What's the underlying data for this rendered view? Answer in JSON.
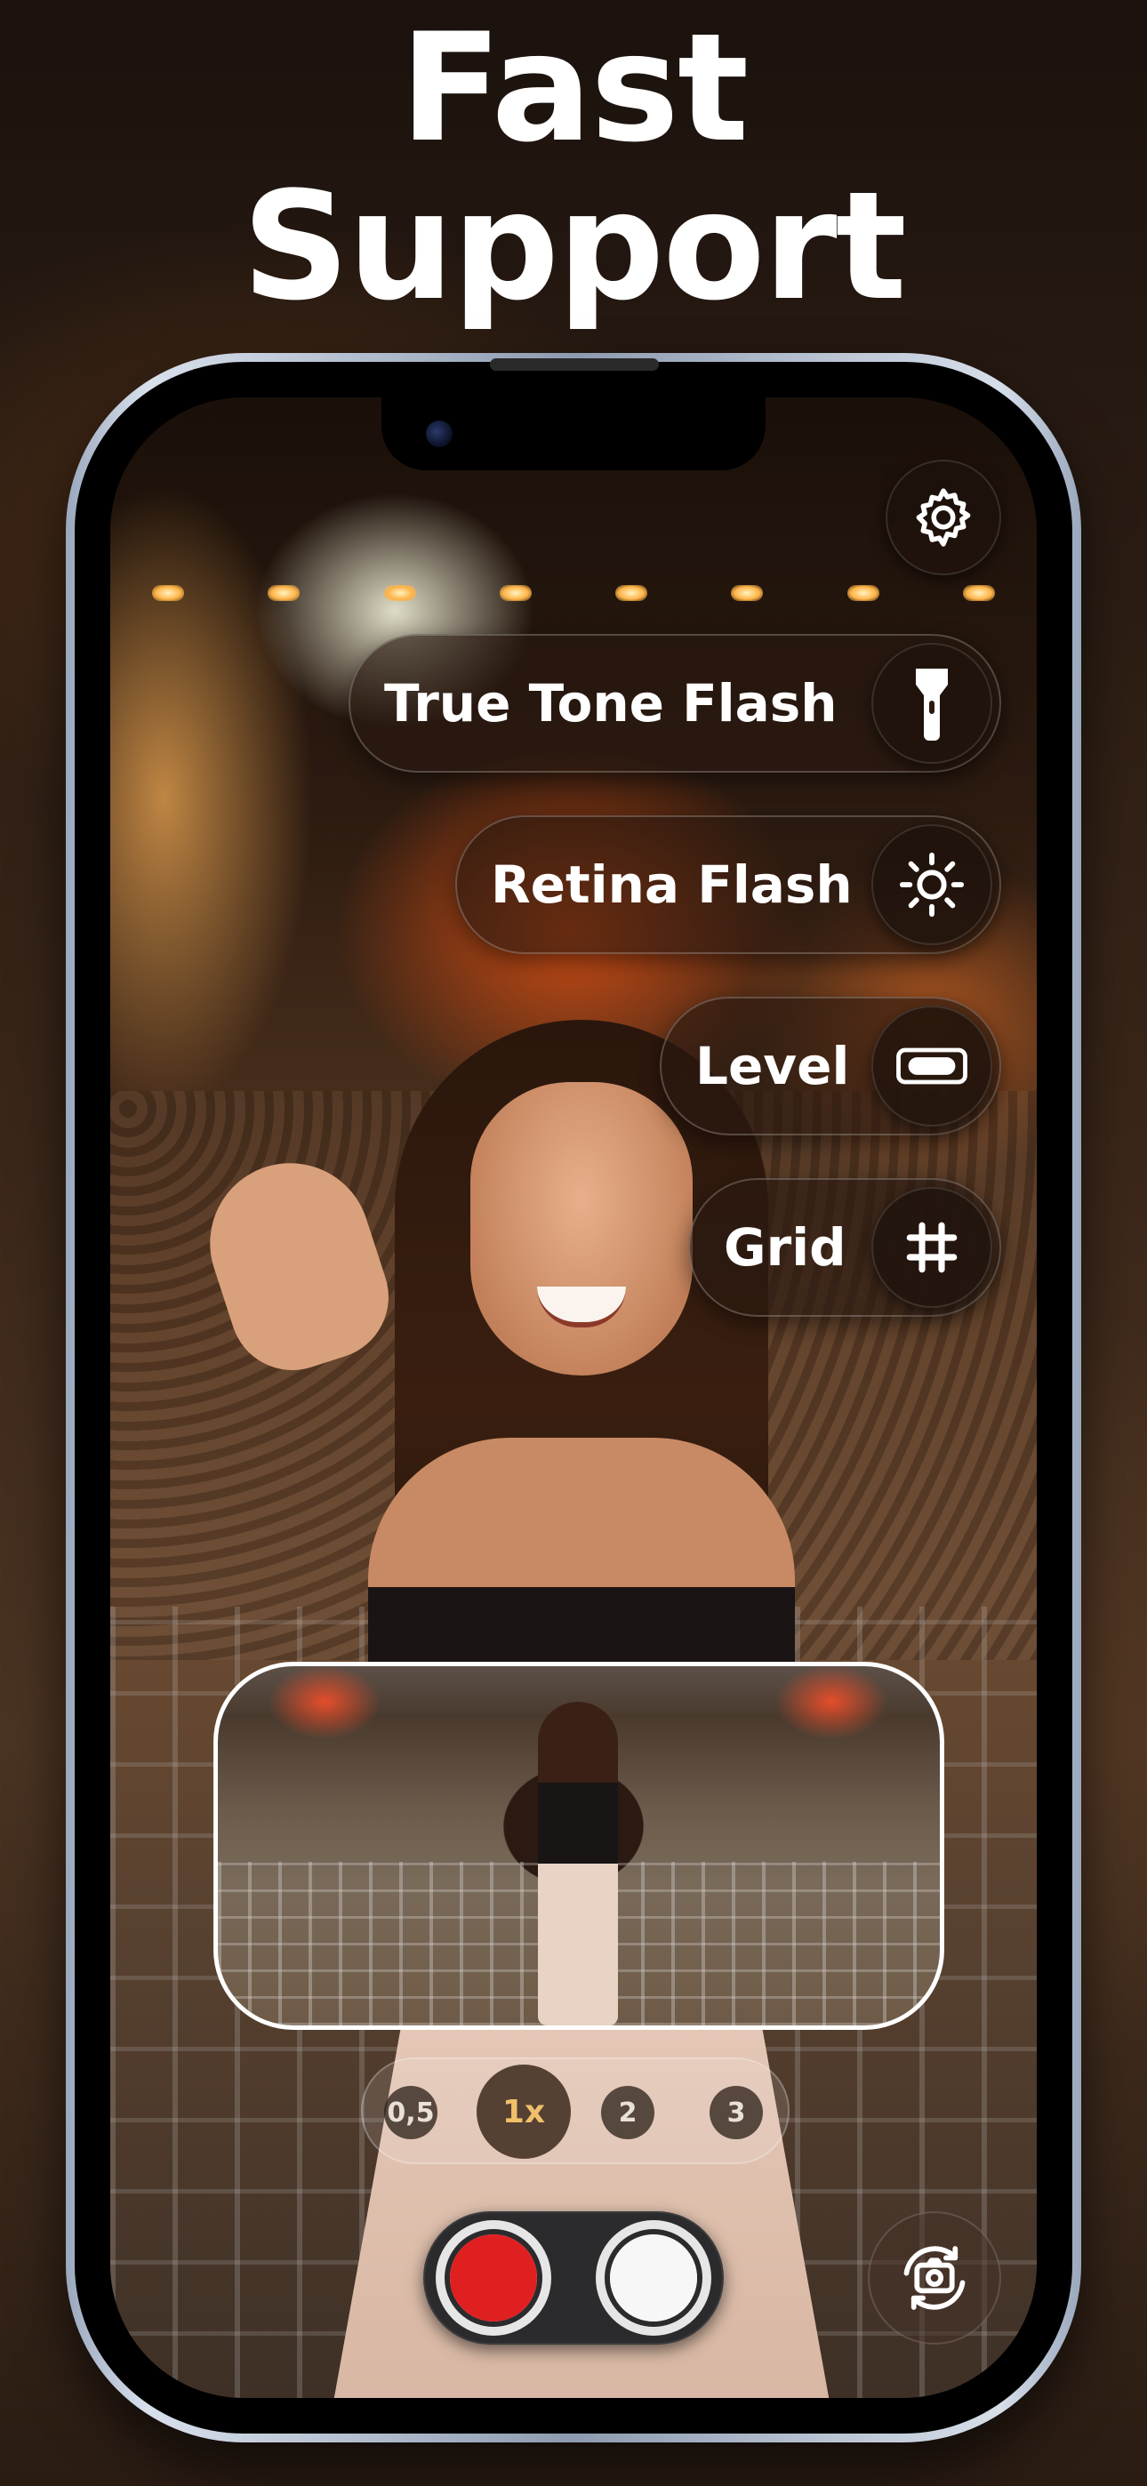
{
  "headline": {
    "line1": "Fast",
    "line2": "Support"
  },
  "camera": {
    "settings_icon": "gear-icon",
    "quick_actions": [
      {
        "label": "True Tone Flash",
        "icon": "flashlight-icon"
      },
      {
        "label": "Retina Flash",
        "icon": "sun-icon"
      },
      {
        "label": "Level",
        "icon": "level-icon"
      },
      {
        "label": "Grid",
        "icon": "grid-icon"
      }
    ],
    "zoom": {
      "options": [
        "0,5",
        "1x",
        "2",
        "3"
      ],
      "selected": "1x"
    },
    "shutter": {
      "record_color": "#e02020",
      "photo_color": "#f7f7f7"
    },
    "flip_icon": "camera-flip-icon"
  },
  "colors": {
    "accent_zoom": "#f0c06a",
    "record": "#e02020"
  }
}
